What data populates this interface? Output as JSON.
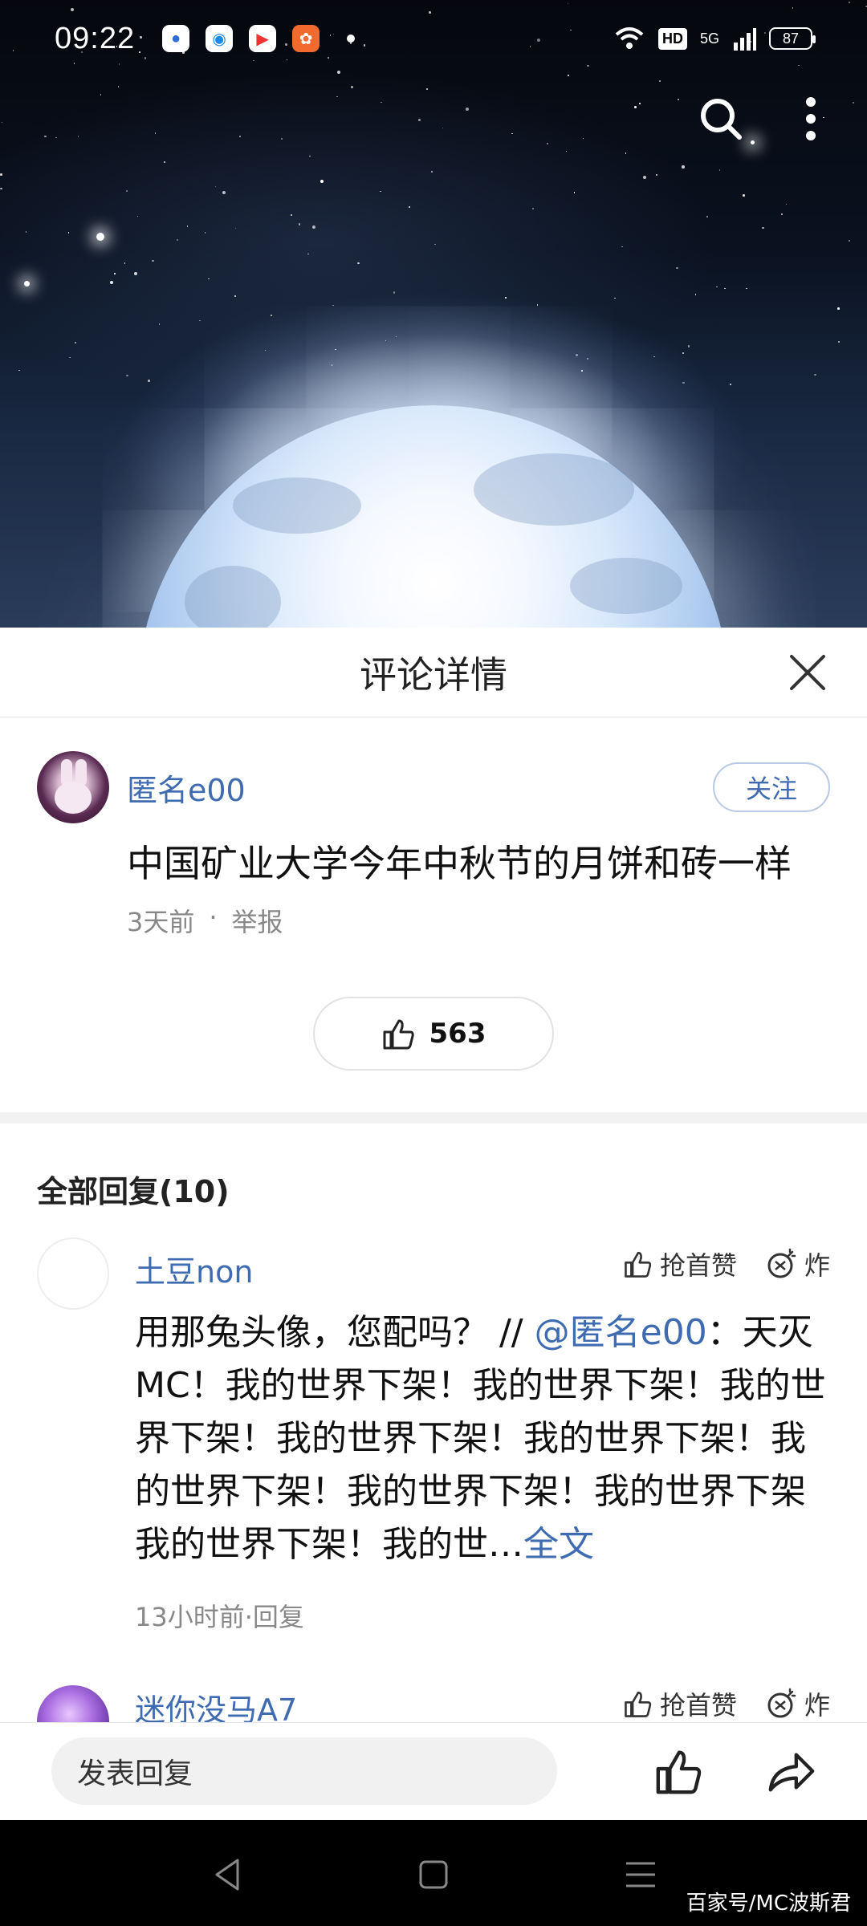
{
  "status_bar": {
    "time": "09:22",
    "network": "5G",
    "hd_label": "HD",
    "battery": "87"
  },
  "sheet": {
    "title": "评论详情"
  },
  "main_comment": {
    "author": "匿名e00",
    "follow_label": "关注",
    "text": "中国矿业大学今年中秋节的月饼和砖一样",
    "time": "3天前",
    "separator": "·",
    "report_label": "举报",
    "like_count": "563"
  },
  "replies_header": "全部回复(10)",
  "replies": [
    {
      "author": "土豆non",
      "first_like_label": "抢首赞",
      "bomb_label": "炸",
      "text_prefix": "用那兔头像，您配吗？ // ",
      "mention": "@匿名e00",
      "text_suffix": "：天灭MC！我的世界下架！我的世界下架！我的世界下架！我的世界下架！我的世界下架！我的世界下架！我的世界下架！我的世界下架我的世界下架！我的世…",
      "full_text_label": "全文",
      "meta": "13小时前·回复"
    },
    {
      "author": "迷你没马A7",
      "first_like_label": "抢首赞",
      "bomb_label": "炸"
    }
  ],
  "input_bar": {
    "placeholder": "发表回复"
  },
  "watermark": "百家号/MC波斯君",
  "colors": {
    "link_blue": "#3f6bb0",
    "text_dark": "#111111",
    "meta_gray": "#888888"
  }
}
